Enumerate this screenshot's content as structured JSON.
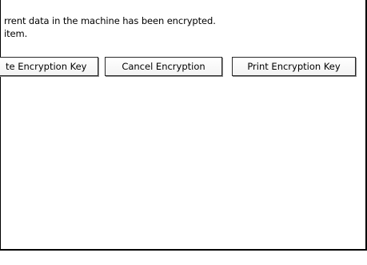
{
  "message": {
    "line1": "rrent data in the machine has been encrypted.",
    "line2": "item."
  },
  "buttons": {
    "update_key": "te Encryption Key",
    "cancel_encryption": "Cancel Encryption",
    "print_key": "Print Encryption Key"
  }
}
